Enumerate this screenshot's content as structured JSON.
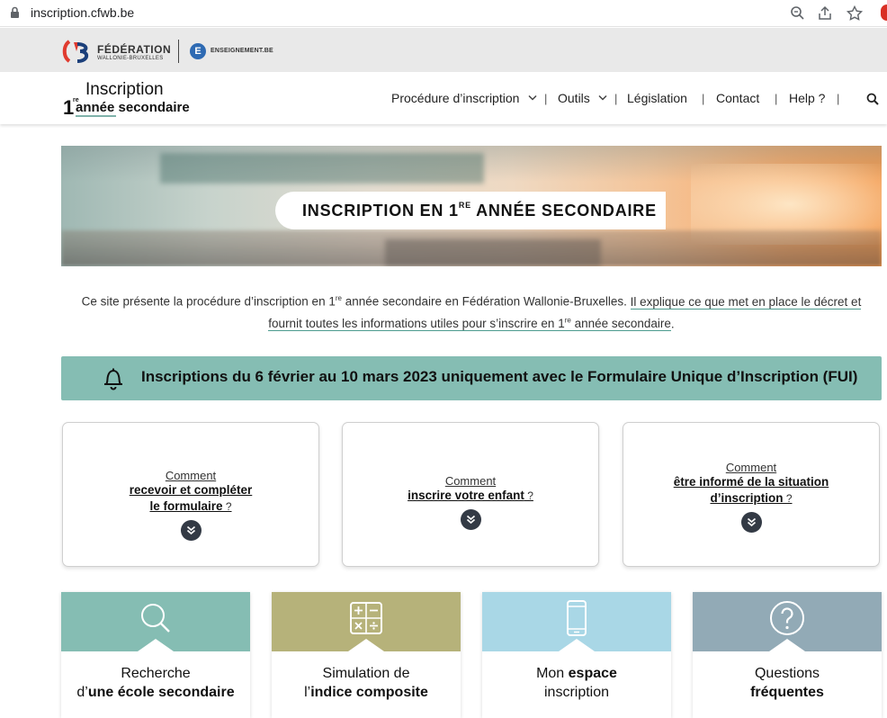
{
  "browser": {
    "url": "inscription.cfwb.be"
  },
  "federation": {
    "name": "FÉDÉRATION",
    "sub": "WALLONIE-BRUXELLES",
    "ens_letter": "E",
    "ens_name": "ENSEIGNEMENT.BE"
  },
  "logo": {
    "number": "1",
    "sup": "re",
    "title": "Inscription",
    "subtitle": "année secondaire"
  },
  "nav": {
    "items": [
      "Procédure d’inscription",
      "Outils",
      "Législation",
      "Contact",
      "Help ?"
    ],
    "separator": "|"
  },
  "hero": {
    "title_a": "INSCRIPTION EN 1",
    "title_sup": "RE",
    "title_b": " ANNÉE SECONDAIRE"
  },
  "intro": {
    "p1": "Ce site présente la procédure d’inscription en 1",
    "sup1": "re",
    "p2": " année secondaire en Fédération Wallonie-Bruxelles. ",
    "link_a": "Il explique ce que met en place le décret et",
    "link_b": "fournit toutes les informations utiles pour s’inscrire en 1",
    "sup2": "re",
    "link_c": " année secondaire",
    "end": "."
  },
  "alert": {
    "text": "Inscriptions du 6 février au 10 mars 2023 uniquement avec le Formulaire Unique d’Inscription (FUI)"
  },
  "cards": [
    {
      "lead": "Comment",
      "line1": "recevoir et compléter",
      "line2": "le formulaire",
      "q": " ?"
    },
    {
      "lead": "Comment",
      "line1": "inscrire votre enfant",
      "q": " ?"
    },
    {
      "lead": "Comment",
      "line1": "être informé de la situation",
      "line2": "d’inscription",
      "q": " ?"
    }
  ],
  "tiles": [
    {
      "l1": "Recherche",
      "l2a": "d’",
      "l2b": "une école secondaire",
      "color": "#85bdb3",
      "icon": "search-icon"
    },
    {
      "l1": "Simulation de",
      "l2a": "l’",
      "l2b": "indice composite",
      "color": "#b6b27a",
      "icon": "calculator-icon"
    },
    {
      "l1a": "Mon ",
      "l1b": "espace",
      "l2": "inscription",
      "color": "#a9d7e6",
      "icon": "smartphone-icon"
    },
    {
      "l1": "Questions",
      "l2b": "fréquentes",
      "color": "#92aab6",
      "icon": "question-icon"
    }
  ]
}
